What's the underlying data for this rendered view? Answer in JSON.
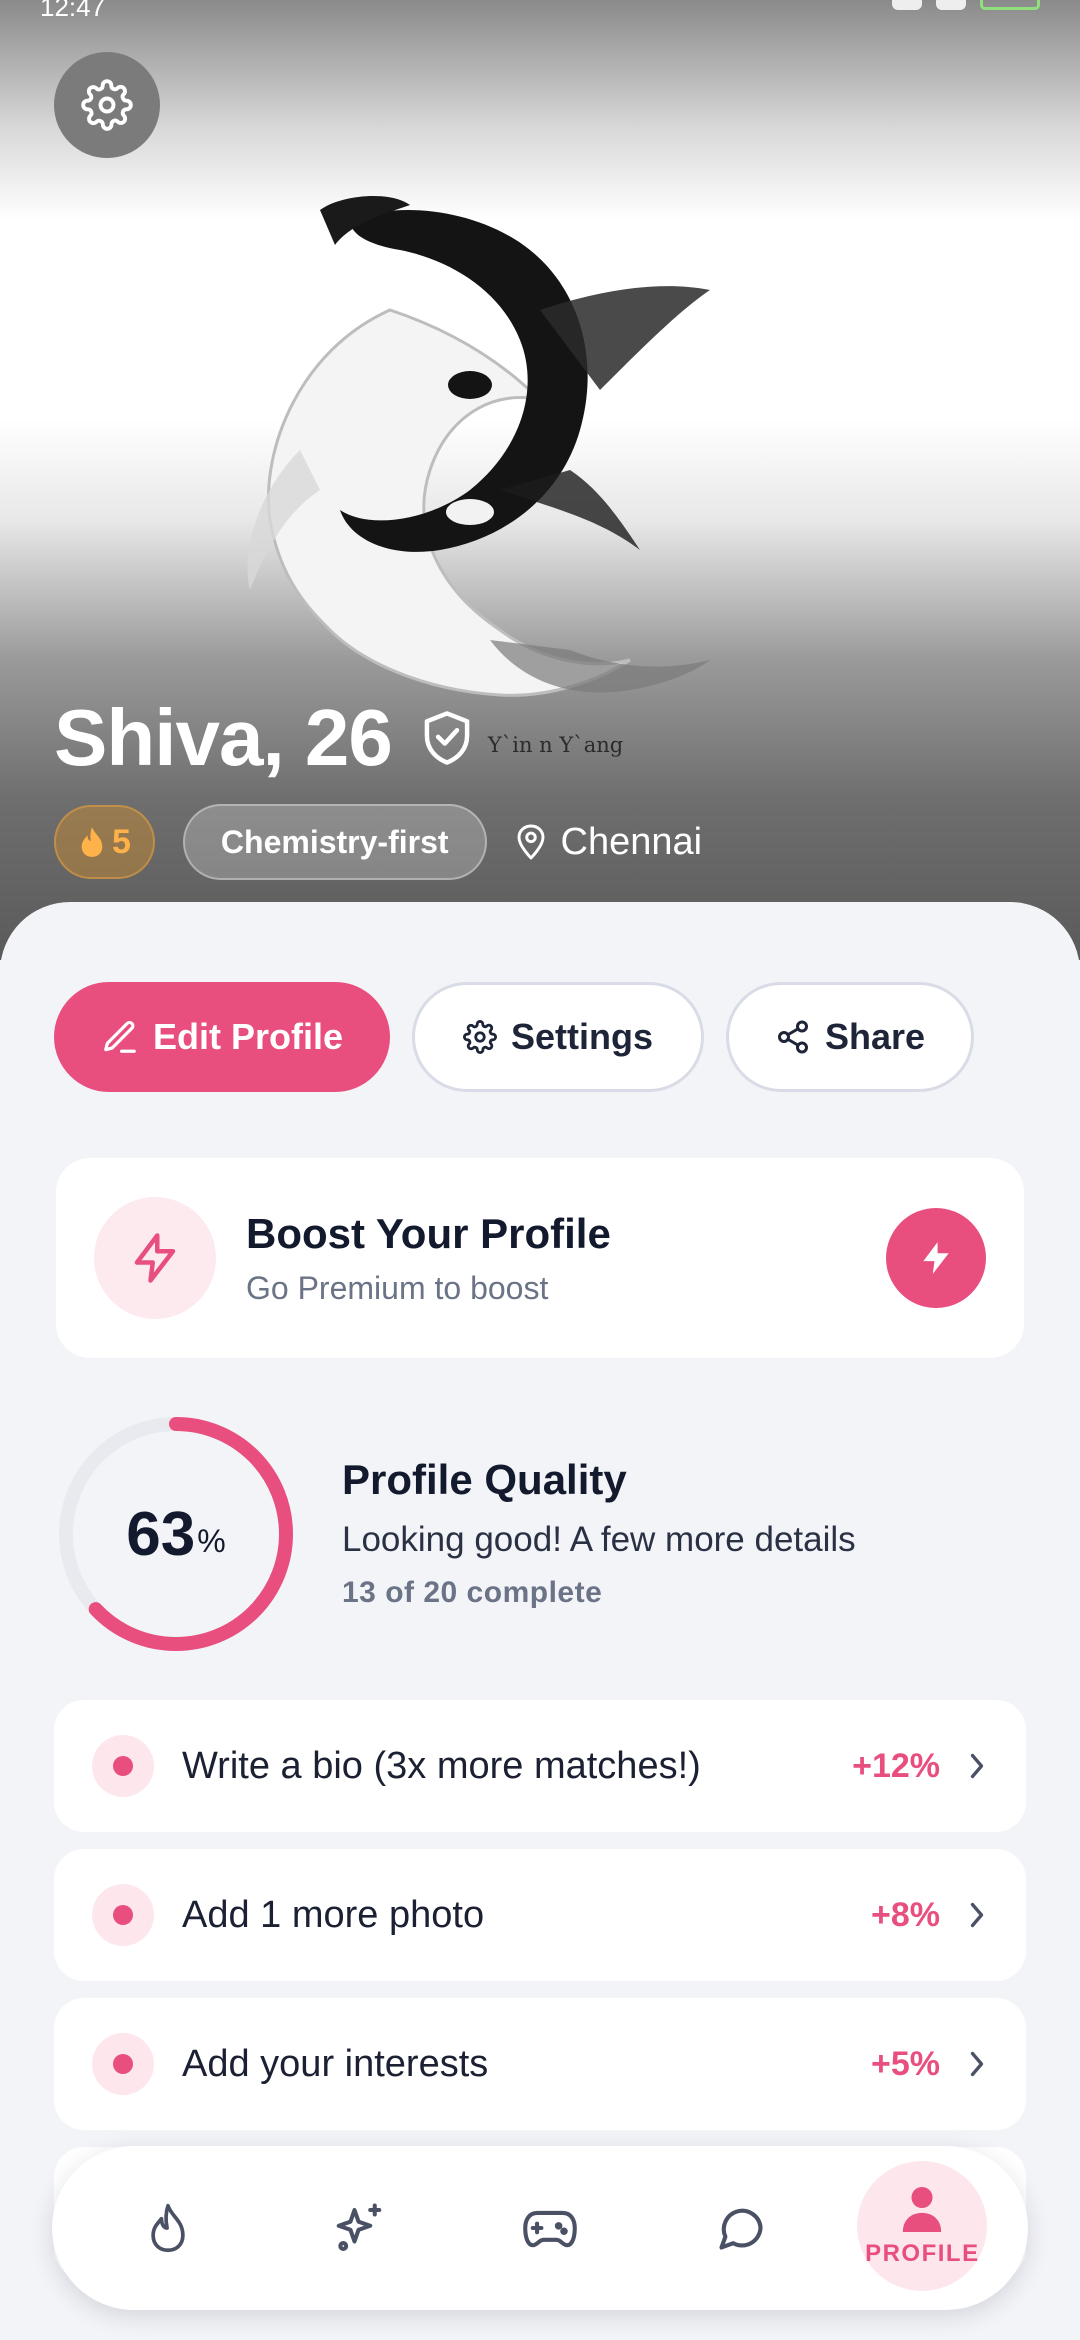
{
  "status_bar": {
    "time": "12:47"
  },
  "profile": {
    "name_age": "Shiva, 26",
    "photo_caption": "Y`in n Y`ang",
    "streak_count": "5",
    "vibe_tag": "Chemistry-first",
    "location": "Chennai"
  },
  "actions": {
    "edit_label": "Edit Profile",
    "settings_label": "Settings",
    "share_label": "Share"
  },
  "boost": {
    "title": "Boost Your Profile",
    "subtitle": "Go Premium to boost"
  },
  "quality": {
    "percent_value": "63",
    "percent_sign": "%",
    "percent_fraction": 0.63,
    "title": "Profile Quality",
    "subtitle": "Looking good! A few more details",
    "progress": "13 of 20 complete"
  },
  "tasks": [
    {
      "label": "Write a bio (3x more matches!)",
      "gain": "+12%"
    },
    {
      "label": "Add 1 more photo",
      "gain": "+8%"
    },
    {
      "label": "Add your interests",
      "gain": "+5%"
    }
  ],
  "nav": {
    "items": [
      "flame-icon",
      "sparkles-icon",
      "gamepad-icon",
      "chat-icon",
      "profile-icon"
    ],
    "active_label": "PROFILE"
  },
  "colors": {
    "accent": "#e84f7f",
    "accent_soft": "#fde7ec",
    "background": "#f3f4f8",
    "streak": "#ffb14a"
  }
}
